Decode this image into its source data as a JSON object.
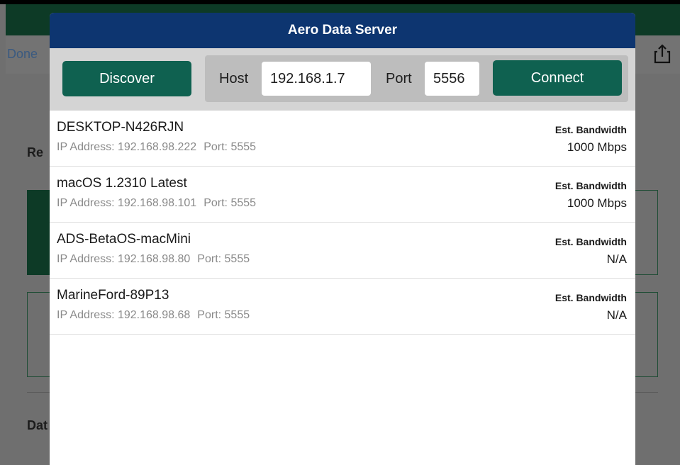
{
  "background": {
    "nav_done_label": "Done",
    "share_icon": "share-icon",
    "section_label_1": "Re",
    "section_label_2": "Dat"
  },
  "modal": {
    "title": "Aero Data Server",
    "discover_label": "Discover",
    "host_label": "Host",
    "host_value": "192.168.1.7",
    "port_label": "Port",
    "port_value": "5556",
    "connect_label": "Connect"
  },
  "servers": [
    {
      "name": "DESKTOP-N426RJN",
      "ip": "IP Address: 192.168.98.222",
      "port": "Port: 5555",
      "bw_label": "Est. Bandwidth",
      "bw_value": "1000 Mbps"
    },
    {
      "name": "macOS 1.2310 Latest",
      "ip": "IP Address: 192.168.98.101",
      "port": "Port: 5555",
      "bw_label": "Est. Bandwidth",
      "bw_value": "1000 Mbps"
    },
    {
      "name": "ADS-BetaOS-macMini",
      "ip": "IP Address: 192.168.98.80",
      "port": "Port: 5555",
      "bw_label": "Est. Bandwidth",
      "bw_value": "N/A"
    },
    {
      "name": "MarineFord-89P13",
      "ip": "IP Address: 192.168.98.68",
      "port": "Port: 5555",
      "bw_label": "Est. Bandwidth",
      "bw_value": "N/A"
    }
  ],
  "colors": {
    "title_bar": "#0d3570",
    "button_green": "#0f6150",
    "toolbar_gray": "#d4d4d4",
    "dim_overlay": "#6f6f6f"
  }
}
